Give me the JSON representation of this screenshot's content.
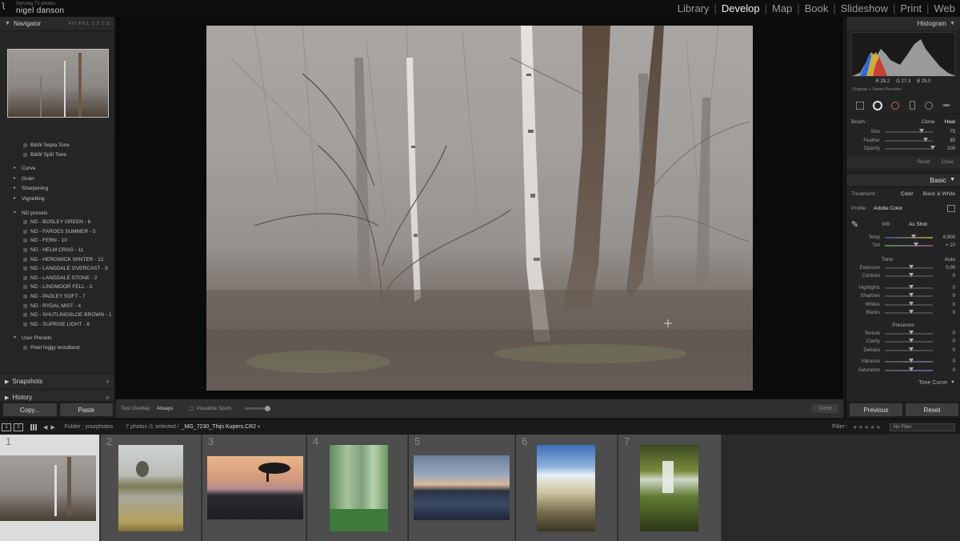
{
  "identity_plate": {
    "sync": "Syncing 71 photos",
    "name": "nigel danson"
  },
  "modules": [
    {
      "label": "Library",
      "active": false
    },
    {
      "label": "Develop",
      "active": true
    },
    {
      "label": "Map",
      "active": false
    },
    {
      "label": "Book",
      "active": false
    },
    {
      "label": "Slideshow",
      "active": false
    },
    {
      "label": "Print",
      "active": false
    },
    {
      "label": "Web",
      "active": false
    }
  ],
  "left": {
    "navigator_title": "Navigator",
    "zoom_options": "FIT  FILL  1:1  1:3",
    "bw_presets": [
      "B&W Sepia Tone",
      "B&W Split Tone"
    ],
    "groups": [
      "Curve",
      "Grain",
      "Sharpening",
      "Vignetting"
    ],
    "nd_group": "ND presets",
    "nd_presets": [
      "ND - BOSLEY GREEN - 6",
      "ND - FAROES SUMMER - 5",
      "ND - FERN - 10",
      "ND - HELM CRAG - 11",
      "ND - HEROWICK WINTER - 12",
      "ND - LANGDALE OVERCAST - 9",
      "ND - LANGDALE STONE - 2",
      "ND - LINGMOOR FELL - 3",
      "ND - PADLEY SOFT - 7",
      "ND - RYDAL MIST - 4",
      "ND - SHUTLINGSLOE BROWN - 1",
      "ND - SUPRISE LIGHT - 8"
    ],
    "user_group": "User Presets",
    "user_presets": [
      "Pixel foggy woodland"
    ],
    "snapshots": "Snapshots",
    "history": "History",
    "copy_label": "Copy...",
    "paste_label": "Paste"
  },
  "toolbar": {
    "overlay_label": "Tool Overlay :",
    "overlay_value": "Always",
    "visualize": "Visualize Spots",
    "done": "Done"
  },
  "right": {
    "histogram_title": "Histogram",
    "histogram_values": [
      "R 29.2",
      "G 27.3",
      "B 25.0"
    ],
    "smart_preview": "Original + Smart Preview",
    "brush_label": "Brush :",
    "brush_clone": "Clone",
    "brush_heal": "Heal",
    "brush_sliders": [
      {
        "label": "Size",
        "value": "75",
        "pos": 0.72
      },
      {
        "label": "Feather",
        "value": "85",
        "pos": 0.8
      },
      {
        "label": "Opacity",
        "value": "100",
        "pos": 0.95
      }
    ],
    "reset": "Reset",
    "close": "Close",
    "basic_title": "Basic",
    "treatment_label": "Treatment :",
    "treatment_color": "Color",
    "treatment_bw": "Black & White",
    "profile_label": "Profile :",
    "profile_value": "Adobe Color",
    "wb_label": "WB :",
    "wb_value": "As Shot",
    "wb_sliders": [
      {
        "label": "Temp",
        "value": "6,900",
        "pos": 0.55
      },
      {
        "label": "Tint",
        "value": "+ 10",
        "pos": 0.6
      }
    ],
    "tone_label": "Tone",
    "auto_label": "Auto",
    "tone_sliders": [
      {
        "label": "Exposure",
        "value": "0.00",
        "pos": 0.5
      },
      {
        "label": "Contrast",
        "value": "0",
        "pos": 0.5
      }
    ],
    "tone_sliders2": [
      {
        "label": "Highlights",
        "value": "0",
        "pos": 0.5
      },
      {
        "label": "Shadows",
        "value": "0",
        "pos": 0.5
      },
      {
        "label": "Whites",
        "value": "0",
        "pos": 0.5
      },
      {
        "label": "Blacks",
        "value": "0",
        "pos": 0.5
      }
    ],
    "presence_label": "Presence",
    "presence_sliders": [
      {
        "label": "Texture",
        "value": "0",
        "pos": 0.5
      },
      {
        "label": "Clarity",
        "value": "0",
        "pos": 0.5
      },
      {
        "label": "Dehaze",
        "value": "0",
        "pos": 0.5
      }
    ],
    "presence_sliders2": [
      {
        "label": "Vibrance",
        "value": "0",
        "pos": 0.5
      },
      {
        "label": "Saturation",
        "value": "0",
        "pos": 0.5
      }
    ],
    "tone_curve_label": "Tone Curve",
    "previous_label": "Previous",
    "reset_label": "Reset"
  },
  "filmstrip_bar": {
    "folder": "Folder : yourphotos",
    "count": "7 photos /1 selected /",
    "file": "_MG_7230_Thijs Kupers.CR2",
    "filter_label": "Filter :",
    "no_filter": "No Filter"
  },
  "filmstrip": [
    "1",
    "2",
    "3",
    "4",
    "5",
    "6",
    "7"
  ]
}
